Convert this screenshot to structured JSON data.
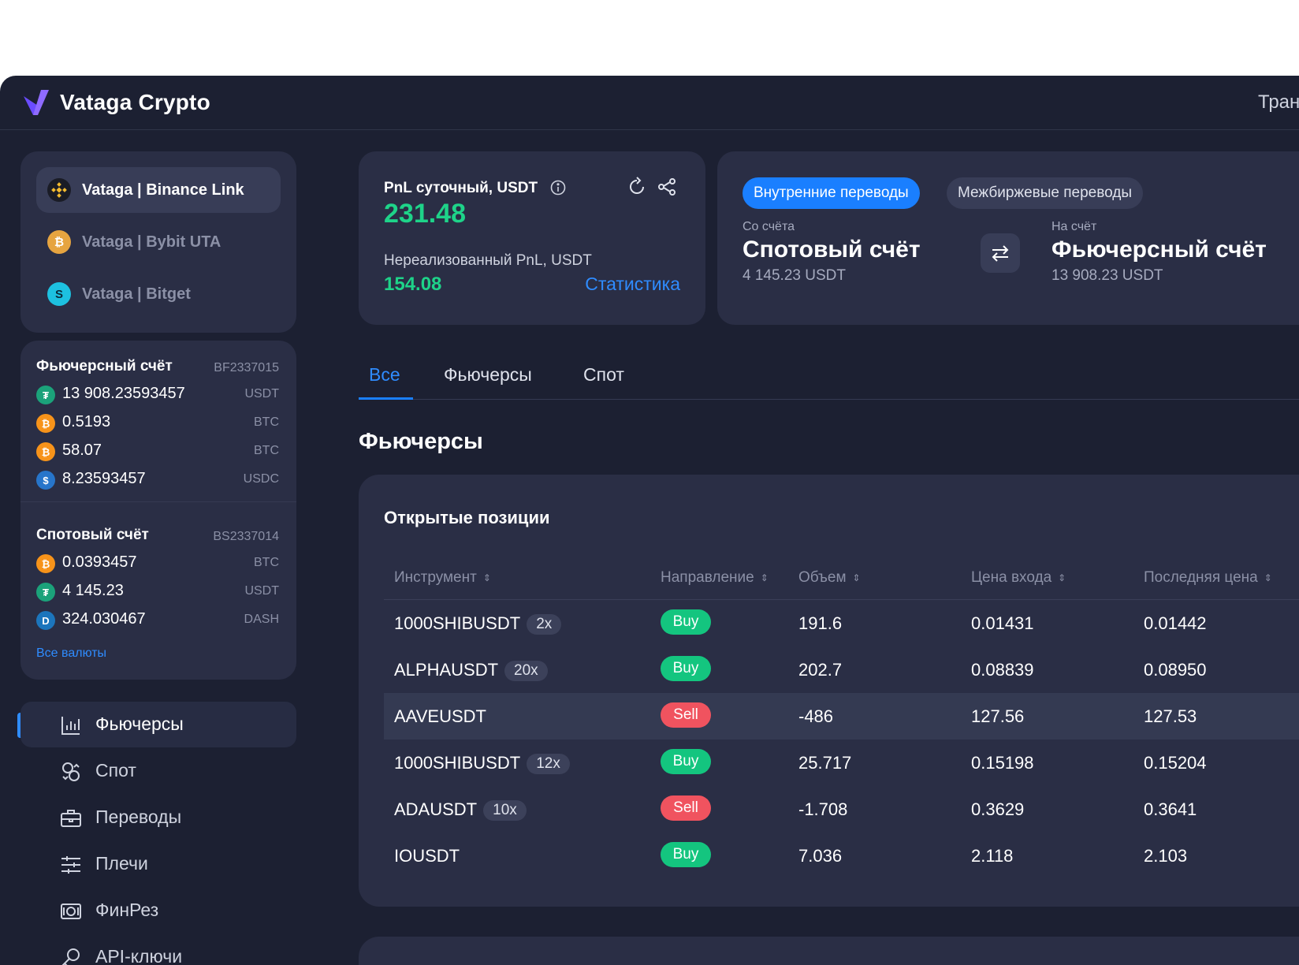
{
  "brand": {
    "name": "Vataga Crypto",
    "top_right": "Тран"
  },
  "exchanges": [
    {
      "label": "Vataga | Binance Link",
      "icon": "binance-icon",
      "color": "#f3ba2f"
    },
    {
      "label": "Vataga | Bybit UTA",
      "icon": "bybit-icon",
      "color": "#f5a623"
    },
    {
      "label": "Vataga | Bitget",
      "icon": "bitget-icon",
      "color": "#1dc1e0"
    }
  ],
  "accounts": {
    "futures": {
      "title": "Фьючерсный счёт",
      "id": "BF2337015",
      "assets": [
        {
          "amount": "13 908.23593457",
          "currency": "USDT",
          "icon": "tether-icon"
        },
        {
          "amount": "0.5193",
          "currency": "BTC",
          "icon": "bitcoin-icon"
        },
        {
          "amount": "58.07",
          "currency": "BTC",
          "icon": "bitcoin-icon"
        },
        {
          "amount": "8.23593457",
          "currency": "USDC",
          "icon": "usdc-icon"
        }
      ]
    },
    "spot": {
      "title": "Спотовый счёт",
      "id": "BS2337014",
      "assets": [
        {
          "amount": "0.0393457",
          "currency": "BTC",
          "icon": "bitcoin-icon"
        },
        {
          "amount": "4 145.23",
          "currency": "USDT",
          "icon": "tether-icon"
        },
        {
          "amount": "324.030467",
          "currency": "DASH",
          "icon": "dash-icon"
        }
      ]
    },
    "all_currencies": "Все валюты"
  },
  "nav": [
    {
      "label": "Фьючерсы",
      "icon": "bar-chart-icon",
      "active": true
    },
    {
      "label": "Спот",
      "icon": "coins-icon"
    },
    {
      "label": "Переводы",
      "icon": "briefcase-icon"
    },
    {
      "label": "Плечи",
      "icon": "sliders-icon"
    },
    {
      "label": "ФинРез",
      "icon": "cash-icon"
    },
    {
      "label": "API-ключи",
      "icon": "key-icon"
    }
  ],
  "pnl": {
    "title": "PnL суточный, USDT",
    "value": "231.48",
    "unrealized_label": "Нереализованный PnL, USDT",
    "unrealized_value": "154.08",
    "stats_link": "Статистика"
  },
  "transfer": {
    "tab_internal": "Внутренние переводы",
    "tab_exchange": "Межбиржевые переводы",
    "from_label": "Со счёта",
    "from_account": "Спотовый счёт",
    "from_amount": "4 145.23 USDT",
    "to_label": "На счёт",
    "to_account": "Фьючерсный счёт",
    "to_amount": "13 908.23 USDT"
  },
  "tabs": [
    "Все",
    "Фьючерсы",
    "Спот"
  ],
  "section_title": "Фьючерсы",
  "positions": {
    "title": "Открытые позиции",
    "headers": [
      "Инструмент",
      "Направление",
      "Объем",
      "Цена входа",
      "Последняя цена"
    ],
    "rows": [
      {
        "instrument": "1000SHIBUSDT",
        "leverage": "2x",
        "direction": "Buy",
        "volume": "191.6",
        "entry": "0.01431",
        "last": "0.01442"
      },
      {
        "instrument": "ALPHAUSDT",
        "leverage": "20x",
        "direction": "Buy",
        "volume": "202.7",
        "entry": "0.08839",
        "last": "0.08950"
      },
      {
        "instrument": "AAVEUSDT",
        "leverage": "",
        "direction": "Sell",
        "volume": "-486",
        "entry": "127.56",
        "last": "127.53"
      },
      {
        "instrument": "1000SHIBUSDT",
        "leverage": "12x",
        "direction": "Buy",
        "volume": "25.717",
        "entry": "0.15198",
        "last": "0.15204"
      },
      {
        "instrument": "ADAUSDT",
        "leverage": "10x",
        "direction": "Sell",
        "volume": "-1.708",
        "entry": "0.3629",
        "last": "0.3641"
      },
      {
        "instrument": "IOUSDT",
        "leverage": "",
        "direction": "Buy",
        "volume": "7.036",
        "entry": "2.118",
        "last": "2.103"
      }
    ]
  },
  "colors": {
    "accent": "#1a7fff",
    "positive": "#1ed389",
    "buy": "#14c57f",
    "sell": "#f0535f",
    "background": "#1c2032",
    "card": "#2a2e45"
  }
}
